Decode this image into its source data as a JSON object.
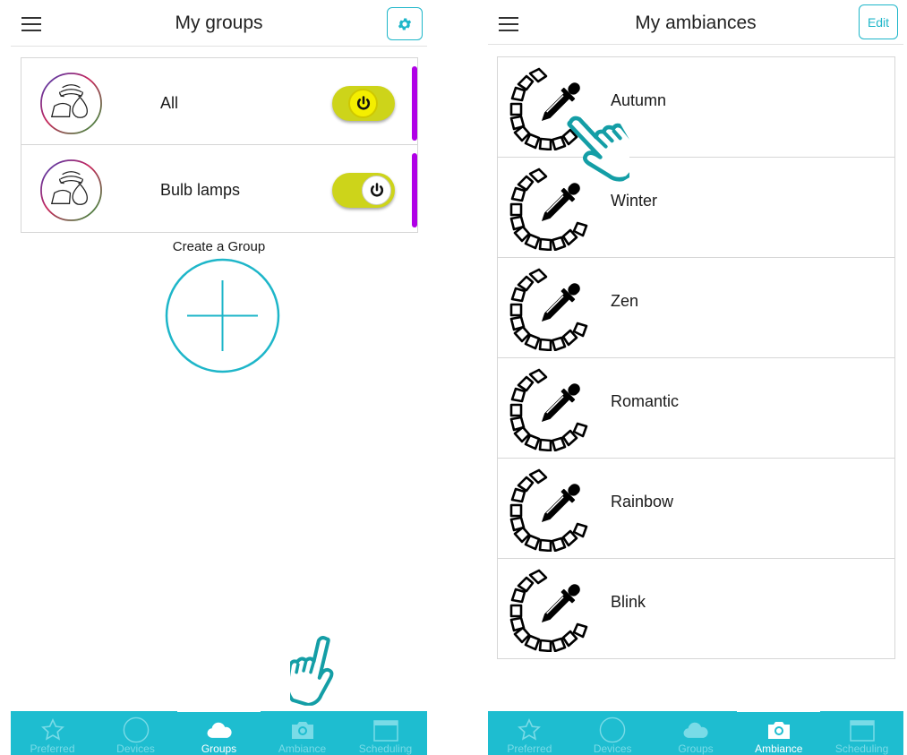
{
  "left_screen": {
    "header": {
      "title": "My groups"
    },
    "groups": [
      {
        "label": "All",
        "state": "on"
      },
      {
        "label": "Bulb lamps",
        "state": "off"
      }
    ],
    "create_group": {
      "label": "Create a Group"
    },
    "tabs": [
      {
        "label": "Preferred",
        "icon": "star-icon",
        "active": false
      },
      {
        "label": "Devices",
        "icon": "circle-icon",
        "active": false
      },
      {
        "label": "Groups",
        "icon": "cloud-icon",
        "active": true
      },
      {
        "label": "Ambiance",
        "icon": "camera-icon",
        "active": false
      },
      {
        "label": "Scheduling",
        "icon": "calendar-icon",
        "active": false
      }
    ]
  },
  "right_screen": {
    "header": {
      "title": "My ambiances",
      "edit_label": "Edit"
    },
    "ambiances": [
      {
        "label": "Autumn"
      },
      {
        "label": "Winter"
      },
      {
        "label": "Zen"
      },
      {
        "label": "Romantic"
      },
      {
        "label": "Rainbow"
      },
      {
        "label": "Blink"
      }
    ],
    "tabs": [
      {
        "label": "Preferred",
        "icon": "star-icon",
        "active": false
      },
      {
        "label": "Devices",
        "icon": "circle-icon",
        "active": false
      },
      {
        "label": "Groups",
        "icon": "cloud-icon",
        "active": false
      },
      {
        "label": "Ambiance",
        "icon": "camera-icon",
        "active": true
      },
      {
        "label": "Scheduling",
        "icon": "calendar-icon",
        "active": false
      }
    ]
  },
  "colors": {
    "accent": "#1ebdd0",
    "toggle_track": "#cdd41a",
    "toggle_knob_on": "#f4ef00",
    "group_bar": "#b000e6",
    "tab_inactive_text": "#79dbe7",
    "pointer_hand": "#149ea6"
  }
}
